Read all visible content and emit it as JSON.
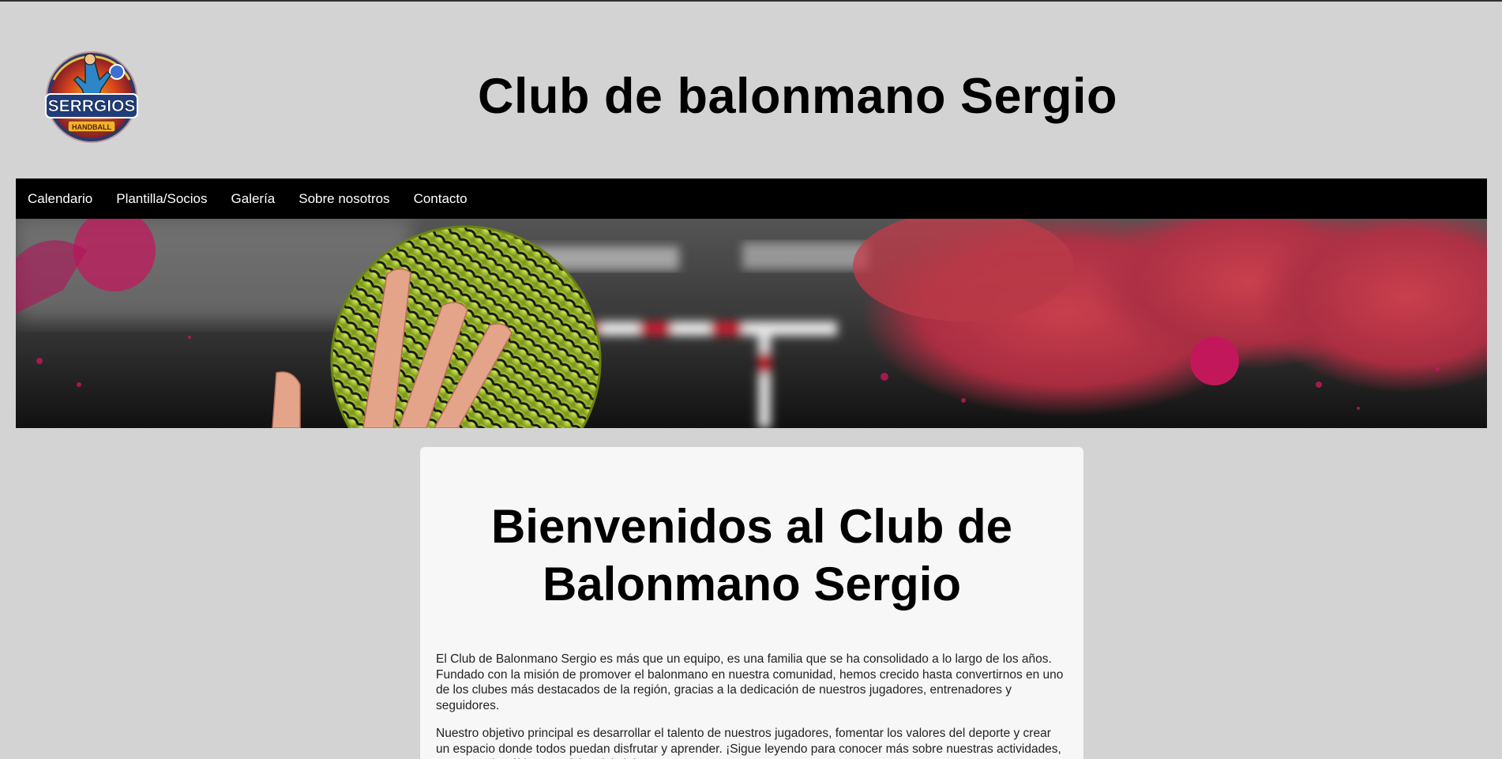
{
  "header": {
    "logo": {
      "name": "Serrgios Handball logo",
      "text_main": "SERRGIOS",
      "text_sub": "HANDBALL"
    },
    "title": "Club de balonmano Sergio"
  },
  "nav": {
    "items": [
      {
        "label": "Calendario"
      },
      {
        "label": "Plantilla/Socios"
      },
      {
        "label": "Galería"
      },
      {
        "label": "Sobre nosotros"
      },
      {
        "label": "Contacto"
      }
    ]
  },
  "banner": {
    "description_icon": "handball-banner-image",
    "colors": {
      "accent_pink": "#c2185b",
      "accent_red": "#c8384a",
      "ball_green": "#b5d334"
    }
  },
  "main": {
    "heading": "Bienvenidos al Club de Balonmano Sergio",
    "paragraphs": [
      "El Club de Balonmano Sergio es más que un equipo, es una familia que se ha consolidado a lo largo de los años. Fundado con la misión de promover el balonmano en nuestra comunidad, hemos crecido hasta convertirnos en uno de los clubes más destacados de la región, gracias a la dedicación de nuestros jugadores, entrenadores y seguidores.",
      "Nuestro objetivo principal es desarrollar el talento de nuestros jugadores, fomentar los valores del deporte y crear un espacio donde todos puedan disfrutar y aprender. ¡Sigue leyendo para conocer más sobre nuestras actividades, eventos y las últimas noticias del club!"
    ]
  }
}
